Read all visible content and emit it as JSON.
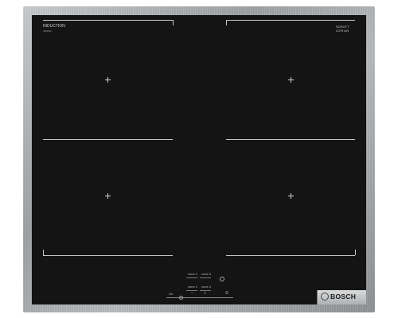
{
  "panel": {
    "brand_label": "INDUCTION",
    "brand_sublabel": "SERIE6",
    "glass_maker": "SCHOTT",
    "glass_line": "CERAN",
    "manufacturer": "BOSCH",
    "zone_labels": [
      "zone 1",
      "zone 3",
      "zone 2",
      "zone 4"
    ],
    "controls": [
      "On",
      "−",
      "+",
      "⏱"
    ]
  }
}
